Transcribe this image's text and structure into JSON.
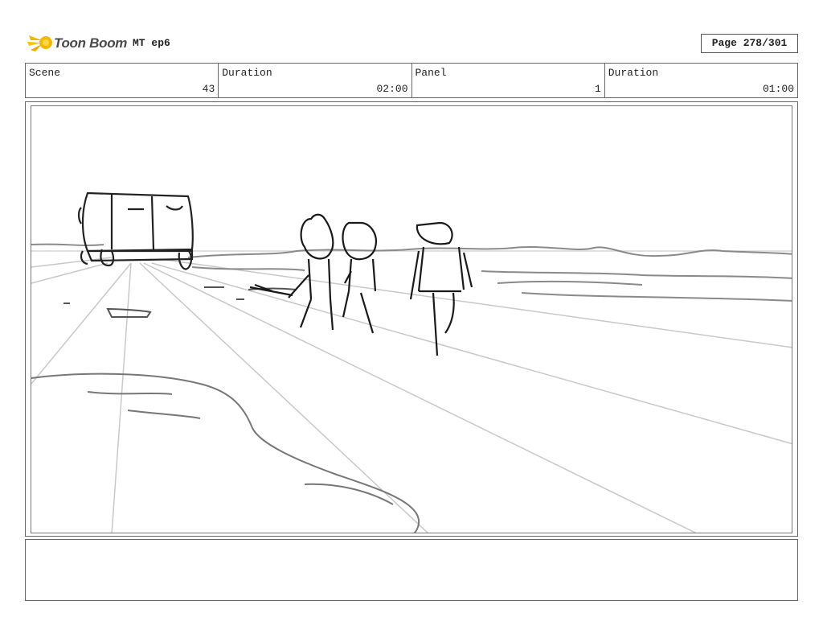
{
  "header": {
    "logo_text": "Toon Boom",
    "project": "MT ep6",
    "page": "Page 278/301"
  },
  "info": {
    "scene_label": "Scene",
    "scene_value": "43",
    "duration_label": "Duration",
    "duration_value": "02:00",
    "panel_label": "Panel",
    "panel_value": "1",
    "panel_duration_label": "Duration",
    "panel_duration_value": "01:00"
  },
  "panel": {
    "content": "storyboard-sketch",
    "icons": [
      "van-sketch",
      "character-sketch"
    ]
  },
  "notes": {
    "text": ""
  },
  "colors": {
    "logo_accent": "#f5b800",
    "border": "#666666"
  }
}
